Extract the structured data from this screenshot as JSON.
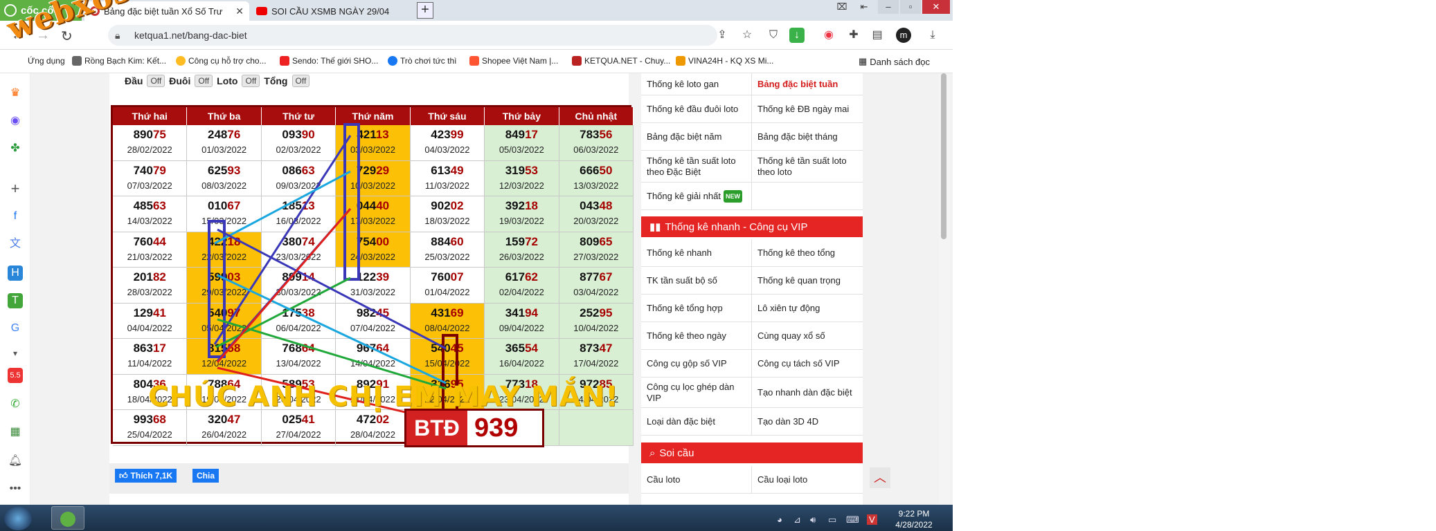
{
  "browser": {
    "brand": "cốc cốc",
    "tabs": [
      {
        "label": "Bảng đặc biệt tuần Xổ Số Trư"
      },
      {
        "label": "SOI CẦU XSMB NGÀY 29/04"
      }
    ],
    "new_tab": "+",
    "url": "ketqua1.net/bang-dac-biet",
    "avatar_letter": "m",
    "bookmarks": [
      "Ứng dụng",
      "Rồng Bạch Kim: Kết...",
      "Công cụ hỗ trợ cho...",
      "Sendo: Thế giới SHO...",
      "Trò chơi tức thì",
      "Shopee Việt Nam |...",
      "KETQUA.NET - Chuy...",
      "VINA24H - KQ XS Mi..."
    ],
    "reading_list": "Danh sách đọc"
  },
  "watermark": "webxoso.net",
  "filters": {
    "labels": [
      "Đầu",
      "Đuôi",
      "Loto",
      "Tổng"
    ],
    "value": "Off"
  },
  "table": {
    "headers": [
      "Thứ hai",
      "Thứ ba",
      "Thứ tư",
      "Thứ năm",
      "Thứ sáu",
      "Thứ bảy",
      "Chủ nhật"
    ],
    "rows": [
      [
        {
          "n": "89075",
          "d": "28/02/2022"
        },
        {
          "n": "24876",
          "d": "01/03/2022"
        },
        {
          "n": "09390",
          "d": "02/03/2022"
        },
        {
          "n": "42113",
          "d": "03/03/2022"
        },
        {
          "n": "42399",
          "d": "04/03/2022"
        },
        {
          "n": "84917",
          "d": "05/03/2022"
        },
        {
          "n": "78356",
          "d": "06/03/2022"
        }
      ],
      [
        {
          "n": "74079",
          "d": "07/03/2022"
        },
        {
          "n": "62593",
          "d": "08/03/2022"
        },
        {
          "n": "08663",
          "d": "09/03/2022"
        },
        {
          "n": "72929",
          "d": "10/03/2022"
        },
        {
          "n": "61349",
          "d": "11/03/2022"
        },
        {
          "n": "31953",
          "d": "12/03/2022"
        },
        {
          "n": "66650",
          "d": "13/03/2022"
        }
      ],
      [
        {
          "n": "48563",
          "d": "14/03/2022"
        },
        {
          "n": "01067",
          "d": "15/03/2022"
        },
        {
          "n": "18513",
          "d": "16/03/2022"
        },
        {
          "n": "04440",
          "d": "17/03/2022"
        },
        {
          "n": "90202",
          "d": "18/03/2022"
        },
        {
          "n": "39218",
          "d": "19/03/2022"
        },
        {
          "n": "04348",
          "d": "20/03/2022"
        }
      ],
      [
        {
          "n": "76044",
          "d": "21/03/2022"
        },
        {
          "n": "42218",
          "d": "22/03/2022"
        },
        {
          "n": "38074",
          "d": "23/03/2022"
        },
        {
          "n": "75400",
          "d": "24/03/2022"
        },
        {
          "n": "88460",
          "d": "25/03/2022"
        },
        {
          "n": "15972",
          "d": "26/03/2022"
        },
        {
          "n": "80965",
          "d": "27/03/2022"
        }
      ],
      [
        {
          "n": "20182",
          "d": "28/03/2022"
        },
        {
          "n": "59903",
          "d": "29/03/2022"
        },
        {
          "n": "89914",
          "d": "30/03/2022"
        },
        {
          "n": "12239",
          "d": "31/03/2022"
        },
        {
          "n": "76007",
          "d": "01/04/2022"
        },
        {
          "n": "61762",
          "d": "02/04/2022"
        },
        {
          "n": "87767",
          "d": "03/04/2022"
        }
      ],
      [
        {
          "n": "12941",
          "d": "04/04/2022"
        },
        {
          "n": "54097",
          "d": "05/04/2022"
        },
        {
          "n": "17538",
          "d": "06/04/2022"
        },
        {
          "n": "98245",
          "d": "07/04/2022"
        },
        {
          "n": "43169",
          "d": "08/04/2022"
        },
        {
          "n": "34194",
          "d": "09/04/2022"
        },
        {
          "n": "25295",
          "d": "10/04/2022"
        }
      ],
      [
        {
          "n": "86317",
          "d": "11/04/2022"
        },
        {
          "n": "81558",
          "d": "12/04/2022"
        },
        {
          "n": "76864",
          "d": "13/04/2022"
        },
        {
          "n": "96764",
          "d": "14/04/2022"
        },
        {
          "n": "54045",
          "d": "15/04/2022"
        },
        {
          "n": "36554",
          "d": "16/04/2022"
        },
        {
          "n": "87347",
          "d": "17/04/2022"
        }
      ],
      [
        {
          "n": "80436",
          "d": "18/04/2022"
        },
        {
          "n": "78864",
          "d": "19/04/2022"
        },
        {
          "n": "58953",
          "d": "20/04/2022"
        },
        {
          "n": "89291",
          "d": "21/04/2022"
        },
        {
          "n": "31695",
          "d": "22/04/2022"
        },
        {
          "n": "77318",
          "d": "23/04/2022"
        },
        {
          "n": "97285",
          "d": "24/04/2022"
        }
      ],
      [
        {
          "n": "99368",
          "d": "25/04/2022"
        },
        {
          "n": "32047",
          "d": "26/04/2022"
        },
        {
          "n": "02541",
          "d": "27/04/2022"
        },
        {
          "n": "47202",
          "d": "28/04/2022"
        }
      ]
    ],
    "colors": {
      "header": "#a80d0d",
      "highlight": "#fcc107",
      "weekend": "#d8efd4",
      "tail": "#a60000"
    }
  },
  "overlay": {
    "message": "CHÚC ANH CHỊ EM MAY MẮN!",
    "btd_label": "BTĐ",
    "btd_value": "939",
    "line_colors": [
      "#3a37b8",
      "#1aa7e0",
      "#20a83a",
      "#e0201c"
    ]
  },
  "share": {
    "like": "Thích 7,1K",
    "share": "Chia"
  },
  "sidebar_links": {
    "top": [
      [
        "Thống kê loto gan",
        "Bảng đặc biệt tuần"
      ],
      [
        "Thống kê đầu đuôi loto",
        "Thống kê ĐB ngày mai"
      ],
      [
        "Bảng đặc biệt năm",
        "Bảng đặc biệt tháng"
      ],
      [
        "Thống kê tần suất loto theo Đặc Biệt",
        "Thống kê tần suất loto theo loto"
      ],
      [
        "Thống kê giải nhất",
        ""
      ]
    ],
    "new_badge": "NEW",
    "vip_title": "Thống kê nhanh - Công cụ VIP",
    "vip": [
      [
        "Thống kê nhanh",
        "Thống kê theo tổng"
      ],
      [
        "TK tần suất bộ số",
        "Thống kê quan trọng"
      ],
      [
        "Thống kê tổng hợp",
        "Lô xiên tự động"
      ],
      [
        "Thống kê theo ngày",
        "Cùng quay xổ số"
      ],
      [
        "Công cụ gộp số VIP",
        "Công cụ tách số VIP"
      ],
      [
        "Công cụ lọc ghép dàn VIP",
        "Tạo nhanh dàn đặc biệt"
      ],
      [
        "Loại dàn đặc biệt",
        "Tạo dàn 3D 4D"
      ]
    ],
    "soi_title": "Soi cầu",
    "soi": [
      [
        "Cầu loto",
        "Cầu loại loto"
      ]
    ]
  },
  "taskbar": {
    "time": "9:22 PM",
    "date": "4/28/2022"
  }
}
